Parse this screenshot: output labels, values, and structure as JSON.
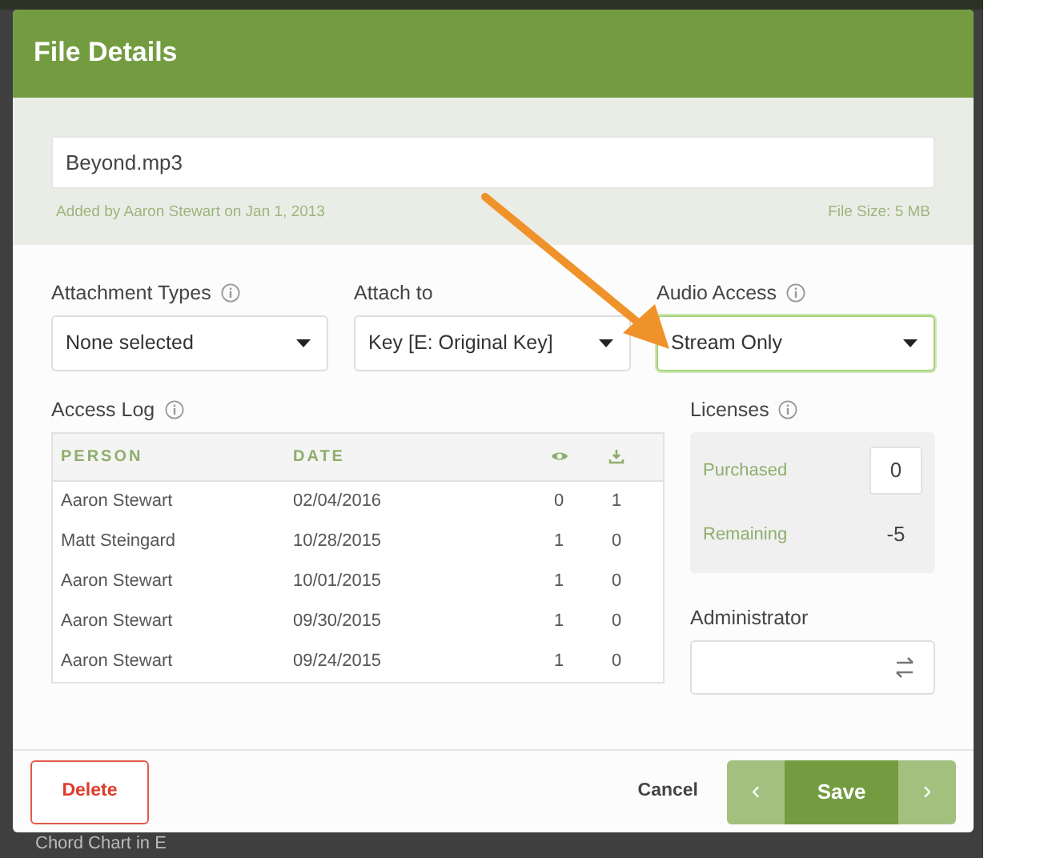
{
  "dialog": {
    "title": "File Details"
  },
  "file": {
    "name": "Beyond.mp3",
    "added": "Added by Aaron Stewart on Jan 1, 2013",
    "size": "File Size: 5 MB"
  },
  "selects": [
    {
      "label": "Attachment Types",
      "info": true,
      "value": "None selected",
      "focused": false
    },
    {
      "label": "Attach to",
      "info": false,
      "value": "Key [E: Original Key]",
      "focused": false
    },
    {
      "label": "Audio Access",
      "info": true,
      "value": "Stream Only",
      "focused": true
    }
  ],
  "access_log": {
    "title": "Access Log",
    "columns": [
      "PERSON",
      "DATE"
    ],
    "rows": [
      {
        "person": "Aaron Stewart",
        "date": "02/04/2016",
        "views": "0",
        "downloads": "1"
      },
      {
        "person": "Matt Steingard",
        "date": "10/28/2015",
        "views": "1",
        "downloads": "0"
      },
      {
        "person": "Aaron Stewart",
        "date": "10/01/2015",
        "views": "1",
        "downloads": "0"
      },
      {
        "person": "Aaron Stewart",
        "date": "09/30/2015",
        "views": "1",
        "downloads": "0"
      },
      {
        "person": "Aaron Stewart",
        "date": "09/24/2015",
        "views": "1",
        "downloads": "0"
      }
    ]
  },
  "licenses": {
    "title": "Licenses",
    "purchased_label": "Purchased",
    "purchased": "0",
    "remaining_label": "Remaining",
    "remaining": "-5"
  },
  "administrator": {
    "label": "Administrator"
  },
  "footer": {
    "delete": "Delete",
    "cancel": "Cancel",
    "save": "Save",
    "prev": "‹",
    "next": "›"
  },
  "background": {
    "item": "Chord Chart in E"
  }
}
